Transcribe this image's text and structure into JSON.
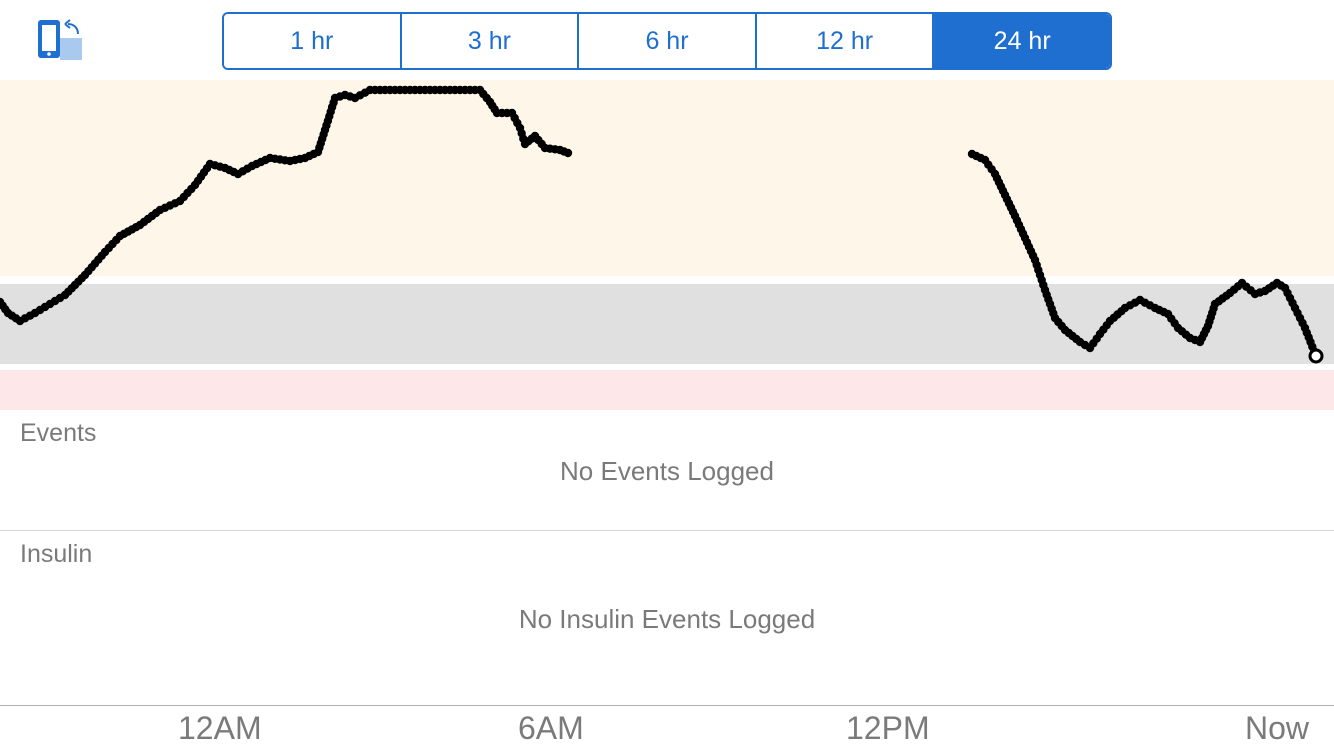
{
  "toolbar": {
    "rotate_icon": "rotate-device-icon",
    "ranges": [
      {
        "label": "1 hr",
        "selected": false
      },
      {
        "label": "3 hr",
        "selected": false
      },
      {
        "label": "6 hr",
        "selected": false
      },
      {
        "label": "12 hr",
        "selected": false
      },
      {
        "label": "24 hr",
        "selected": true
      }
    ],
    "accent_color": "#1e6fcf"
  },
  "glucose_chart": {
    "zones": [
      {
        "name": "high",
        "color": "#fdf6e9"
      },
      {
        "name": "target",
        "color": "#e0e0e0"
      },
      {
        "name": "low",
        "color": "#fde7e8"
      }
    ],
    "x_labels": [
      "12AM",
      "6AM",
      "12PM",
      "Now"
    ]
  },
  "events": {
    "title": "Events",
    "empty_message": "No Events Logged"
  },
  "insulin": {
    "title": "Insulin",
    "empty_message": "No Insulin Events Logged"
  }
}
